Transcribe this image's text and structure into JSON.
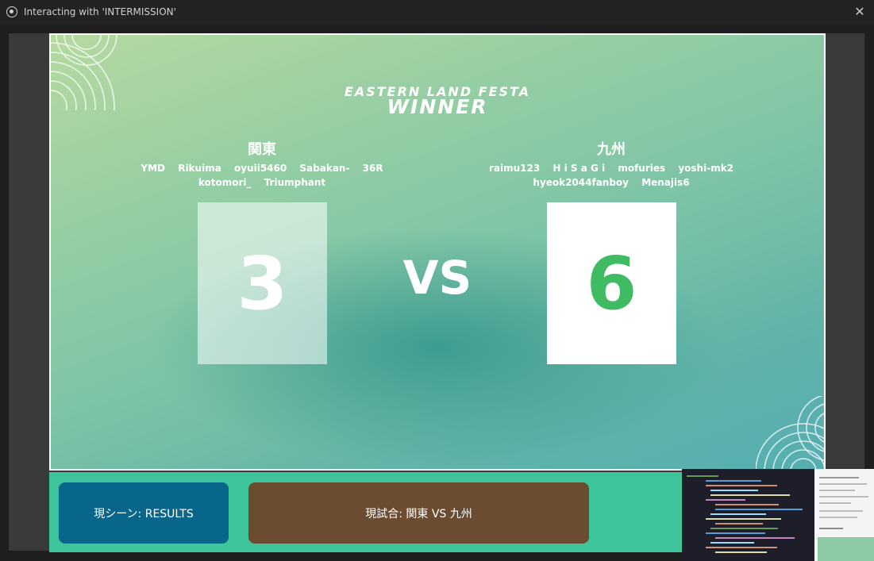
{
  "window": {
    "title": "Interacting with 'INTERMISSION'",
    "close_label": "✕"
  },
  "scene": {
    "event_title": "EASTERN LAND FESTA",
    "subtitle": "WINNER",
    "vs_label": "VS",
    "left_team": {
      "name": "関東",
      "players_row1": [
        "YMD",
        "Rikuima",
        "oyuii5460",
        "Sabakan-",
        "36R"
      ],
      "players_row2": [
        "kotomori_",
        "Triumphant"
      ],
      "score": "3"
    },
    "right_team": {
      "name": "九州",
      "players_row1": [
        "raimu123",
        "H i S a G i",
        "mofuries",
        "yoshi-mk2"
      ],
      "players_row2": [
        "hyeok2044fanboy",
        "Menajis6"
      ],
      "score": "6"
    }
  },
  "controls": {
    "current_scene_label": "現シーン: RESULTS",
    "current_match_label": "現試合: 関東 VS 九州"
  },
  "colors": {
    "scene_button": "#07668a",
    "match_button": "#6b4c31",
    "bottom_bar": "#3dc49a",
    "winner_score": "#3fbb63"
  }
}
